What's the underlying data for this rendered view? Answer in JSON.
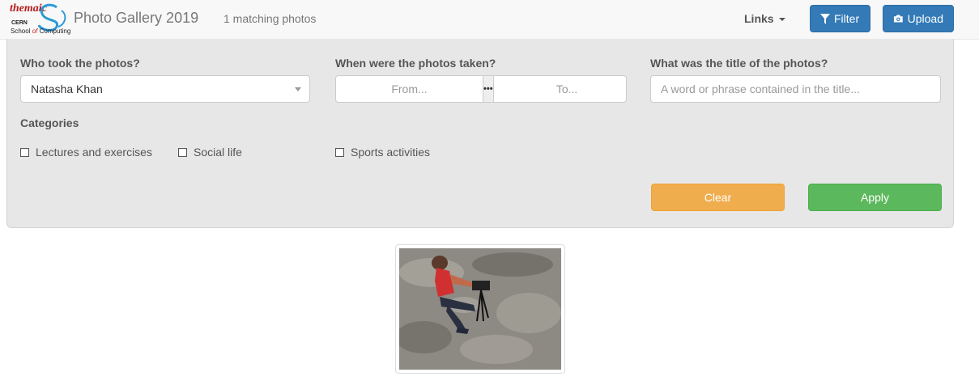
{
  "logo": {
    "word": "themaic",
    "org": "CERN",
    "school_prefix": "School",
    "school_of": "of",
    "school_suffix": "Computing"
  },
  "header": {
    "brand": "Photo Gallery 2019",
    "matching": "1 matching photos",
    "links_label": "Links",
    "filter_label": "Filter",
    "upload_label": "Upload"
  },
  "filters": {
    "photographer_label": "Who took the photos?",
    "photographer_value": "Natasha Khan",
    "date_label": "When were the photos taken?",
    "date_from_placeholder": "From...",
    "date_to_placeholder": "To...",
    "date_separator": "•••",
    "title_label": "What was the title of the photos?",
    "title_placeholder": "A word or phrase contained in the title...",
    "categories_label": "Categories",
    "categories": [
      {
        "label": "Lectures and exercises",
        "checked": false
      },
      {
        "label": "Social life",
        "checked": false
      },
      {
        "label": "Sports activities",
        "checked": false
      }
    ],
    "clear_label": "Clear",
    "apply_label": "Apply"
  },
  "colors": {
    "primary": "#337ab7",
    "warning": "#f0ad4e",
    "success": "#5cb85c",
    "panel_bg": "#e7e7e7"
  },
  "icons": {
    "filter": "filter-icon",
    "upload": "camera-icon",
    "links_caret": "caret-down-icon",
    "select_arrow": "chevron-down-icon"
  },
  "gallery": {
    "photos": [
      {
        "subject": "person in red shirt photographing with camera on tripod"
      }
    ]
  }
}
